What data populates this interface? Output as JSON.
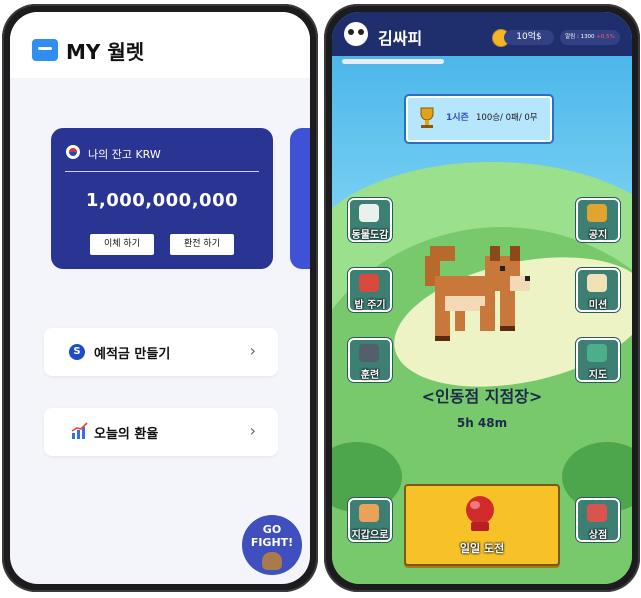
{
  "wallet": {
    "title": "MY 월렛",
    "balance_label": "나의 잔고 KRW",
    "balance_value": "1,000,000,000",
    "transfer_button": "이체 하기",
    "exchange_button": "환전 하기",
    "menu_items": [
      {
        "label": "예적금 만들기",
        "icon": "savings-icon"
      },
      {
        "label": "오늘의 환율",
        "icon": "chart-icon"
      }
    ],
    "fight_button": "GO\nFIGHT!"
  },
  "game": {
    "player_name": "김싸피",
    "coins": "10억$",
    "alert_text": "알림 : 1300",
    "alert_highlight": "+0.5%",
    "season": "1시즌",
    "record": "100승/ 0패/ 0무",
    "left_buttons": [
      "동물도감",
      "밥 주기",
      "훈련"
    ],
    "right_buttons": [
      "공지",
      "미션",
      "지도"
    ],
    "location": "<인동점 지점장>",
    "timer": "5h 48m",
    "wallet_button": "지갑으로",
    "daily_challenge": "일일 도전",
    "shop_button": "상점"
  },
  "colors": {
    "card_navy": "#2a3593",
    "accent_blue": "#3f52d6",
    "game_topbar": "#1f2f6e",
    "challenge_yellow": "#f6c228"
  }
}
